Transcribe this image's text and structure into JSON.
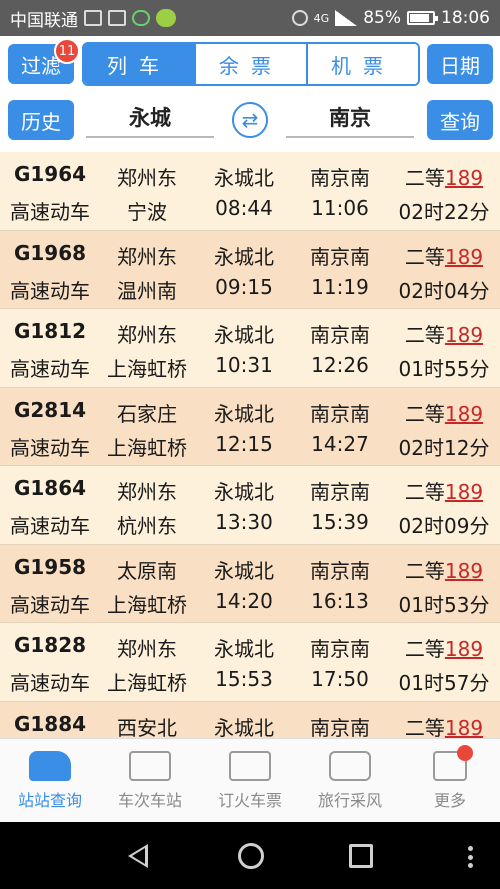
{
  "status_bar": {
    "carrier": "中国联通",
    "network": "4G",
    "battery": "85%",
    "time": "18:06"
  },
  "top": {
    "filter_label": "过滤",
    "filter_badge": "11",
    "tabs": [
      {
        "label": "列车",
        "active": true
      },
      {
        "label": "余票",
        "active": false
      },
      {
        "label": "机票",
        "active": false
      }
    ],
    "date_label": "日期"
  },
  "search": {
    "history_label": "历史",
    "from": "永城",
    "to": "南京",
    "query_label": "查询"
  },
  "trains": [
    {
      "no": "G1964",
      "type": "高速动车",
      "origin": "郑州东",
      "dest": "宁波",
      "board": "永城北",
      "depart": "08:44",
      "alight": "南京南",
      "arrive": "11:06",
      "seat": "二等",
      "price": "189",
      "duration": "02时22分"
    },
    {
      "no": "G1968",
      "type": "高速动车",
      "origin": "郑州东",
      "dest": "温州南",
      "board": "永城北",
      "depart": "09:15",
      "alight": "南京南",
      "arrive": "11:19",
      "seat": "二等",
      "price": "189",
      "duration": "02时04分"
    },
    {
      "no": "G1812",
      "type": "高速动车",
      "origin": "郑州东",
      "dest": "上海虹桥",
      "board": "永城北",
      "depart": "10:31",
      "alight": "南京南",
      "arrive": "12:26",
      "seat": "二等",
      "price": "189",
      "duration": "01时55分"
    },
    {
      "no": "G2814",
      "type": "高速动车",
      "origin": "石家庄",
      "dest": "上海虹桥",
      "board": "永城北",
      "depart": "12:15",
      "alight": "南京南",
      "arrive": "14:27",
      "seat": "二等",
      "price": "189",
      "duration": "02时12分"
    },
    {
      "no": "G1864",
      "type": "高速动车",
      "origin": "郑州东",
      "dest": "杭州东",
      "board": "永城北",
      "depart": "13:30",
      "alight": "南京南",
      "arrive": "15:39",
      "seat": "二等",
      "price": "189",
      "duration": "02时09分"
    },
    {
      "no": "G1958",
      "type": "高速动车",
      "origin": "太原南",
      "dest": "上海虹桥",
      "board": "永城北",
      "depart": "14:20",
      "alight": "南京南",
      "arrive": "16:13",
      "seat": "二等",
      "price": "189",
      "duration": "01时53分"
    },
    {
      "no": "G1828",
      "type": "高速动车",
      "origin": "郑州东",
      "dest": "上海虹桥",
      "board": "永城北",
      "depart": "15:53",
      "alight": "南京南",
      "arrive": "17:50",
      "seat": "二等",
      "price": "189",
      "duration": "01时57分"
    },
    {
      "no": "G1884",
      "type": "",
      "origin": "西安北",
      "dest": "",
      "board": "永城北",
      "depart": "",
      "alight": "南京南",
      "arrive": "",
      "seat": "二等",
      "price": "189",
      "duration": ""
    }
  ],
  "bottom_nav": [
    {
      "label": "站站查询",
      "icon": "train-icon",
      "active": true
    },
    {
      "label": "车次车站",
      "icon": "briefcase-icon",
      "active": false
    },
    {
      "label": "订火车票",
      "icon": "ticket-icon",
      "active": false
    },
    {
      "label": "旅行采风",
      "icon": "chat-bubble-icon",
      "active": false
    },
    {
      "label": "更多",
      "icon": "grid-icon",
      "active": false
    }
  ],
  "colors": {
    "accent": "#3a8ee6",
    "row_light": "#fdf1dc",
    "row_dark": "#f9dfc3",
    "price": "#c62828",
    "badge": "#e8473a"
  }
}
